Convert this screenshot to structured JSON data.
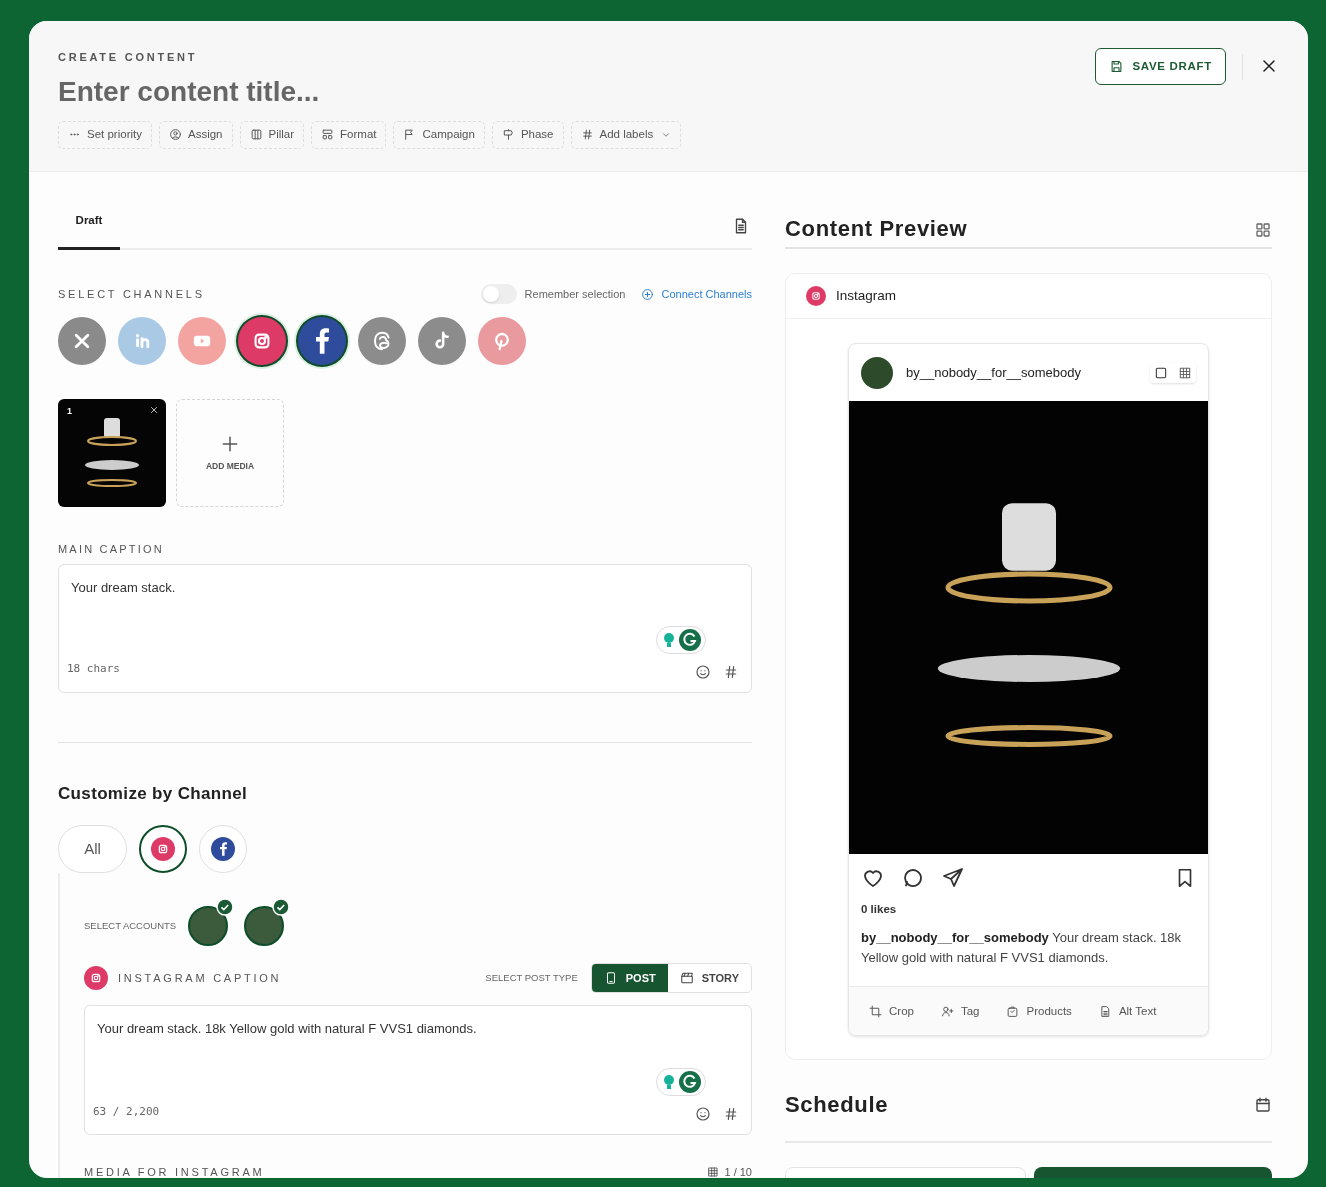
{
  "header": {
    "eyebrow": "CREATE CONTENT",
    "title_placeholder": "Enter content title...",
    "save_button": "SAVE DRAFT",
    "chips": [
      {
        "kind": "dots",
        "label": "Set priority"
      },
      {
        "kind": "user",
        "label": "Assign"
      },
      {
        "kind": "columns",
        "label": "Pillar"
      },
      {
        "kind": "format",
        "label": "Format"
      },
      {
        "kind": "flag",
        "label": "Campaign"
      },
      {
        "kind": "signpost",
        "label": "Phase"
      },
      {
        "kind": "hash",
        "label": "Add labels"
      }
    ]
  },
  "editor": {
    "tabs": [
      {
        "label": "Draft",
        "selected": true
      }
    ],
    "channels_label": "SELECT CHANNELS",
    "remember": {
      "label": "Remember selection",
      "on": false
    },
    "connect": "Connect Channels",
    "channels": [
      {
        "kind": "x",
        "color": "#8a8a8a",
        "selected": false
      },
      {
        "kind": "linkedin",
        "color": "#a9c9e5",
        "selected": false
      },
      {
        "kind": "youtube",
        "color": "#f3a4a0",
        "selected": false
      },
      {
        "kind": "instagram",
        "color": "#dd3a67",
        "selected": true
      },
      {
        "kind": "facebook",
        "color": "#2f4b9b",
        "selected": true
      },
      {
        "kind": "threads",
        "color": "#8c8c8c",
        "selected": false
      },
      {
        "kind": "tiktok",
        "color": "#8c8c8c",
        "selected": false
      },
      {
        "kind": "pinterest",
        "color": "#e99a9e",
        "selected": false
      }
    ],
    "media": [
      {
        "index": "1"
      }
    ],
    "add_media": "ADD MEDIA",
    "caption_label": "MAIN CAPTION",
    "caption": "Your dream stack.",
    "char_count": "18 chars"
  },
  "customize": {
    "title": "Customize by Channel",
    "tabs": [
      {
        "kind": "all",
        "label": "All",
        "selected": false
      },
      {
        "kind": "instagram",
        "selected": true
      },
      {
        "kind": "facebook",
        "selected": false
      }
    ],
    "accounts_label": "SELECT ACCOUNTS",
    "accounts": [
      {
        "checked": true
      },
      {
        "checked": true
      }
    ],
    "caption_label": "INSTAGRAM CAPTION",
    "post_type_label": "SELECT POST TYPE",
    "post_types": [
      {
        "kind": "post",
        "label": "POST",
        "selected": true
      },
      {
        "kind": "story",
        "label": "STORY",
        "selected": false
      }
    ],
    "caption": "Your dream stack. 18k Yellow gold with natural F VVS1 diamonds.",
    "count": "63 / 2,200",
    "media_label": "MEDIA FOR INSTAGRAM",
    "media_count": "1 / 10"
  },
  "preview": {
    "title": "Content Preview",
    "network": "Instagram",
    "username": "by__nobody__for__somebody",
    "likes": "0 likes",
    "caption": "**by__nobody__for__somebody** Your dream stack. 18k Yellow gold with natural F VVS1 diamonds.",
    "tools": [
      {
        "kind": "crop",
        "label": "Crop"
      },
      {
        "kind": "tag",
        "label": "Tag"
      },
      {
        "kind": "products",
        "label": "Products"
      },
      {
        "kind": "alt",
        "label": "Alt Text"
      }
    ]
  },
  "schedule": {
    "title": "Schedule"
  }
}
